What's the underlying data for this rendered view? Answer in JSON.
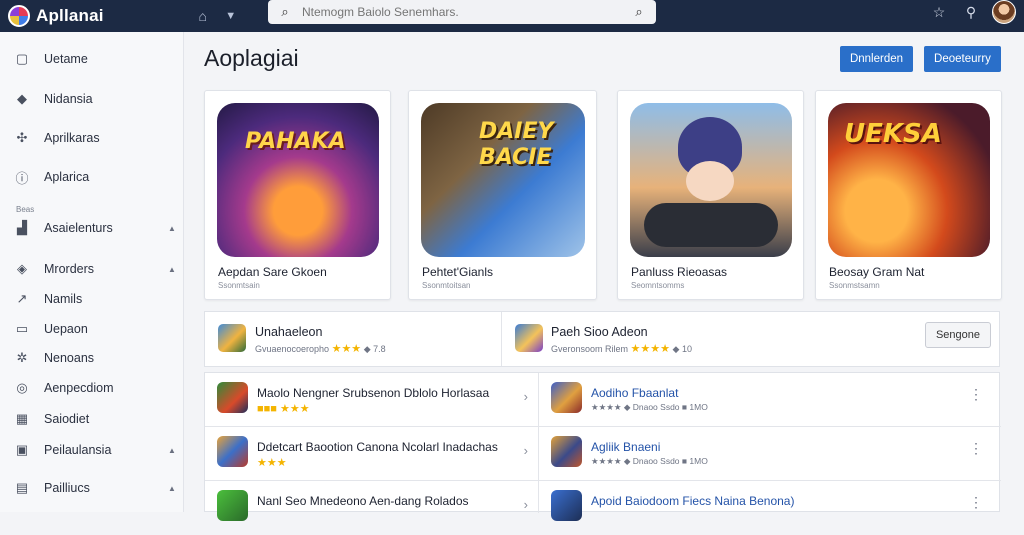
{
  "topbar": {
    "app_name": "Apllanai",
    "search_placeholder": "Ntemogm Baiolo Senemhars."
  },
  "sidebar": {
    "section_label": "Beas",
    "items": [
      {
        "label": "Uetame",
        "icon": "window-icon",
        "arrow": false
      },
      {
        "label": "Nidansia",
        "icon": "diamond-icon",
        "arrow": false
      },
      {
        "label": "Aprilkaras",
        "icon": "puzzle-icon",
        "arrow": false
      },
      {
        "label": "Aplarica",
        "icon": "info-icon",
        "arrow": false
      },
      {
        "label": "Asaielenturs",
        "icon": "chart-icon",
        "arrow": true
      },
      {
        "label": "Mrorders",
        "icon": "layers-icon",
        "arrow": true
      },
      {
        "label": "Namils",
        "icon": "trend-icon",
        "arrow": false
      },
      {
        "label": "Uepaon",
        "icon": "folder-icon",
        "arrow": false
      },
      {
        "label": "Nenoans",
        "icon": "gear-icon",
        "arrow": false
      },
      {
        "label": "Aenpecdiom",
        "icon": "globe-icon",
        "arrow": false
      },
      {
        "label": "Saiodiet",
        "icon": "calendar-icon",
        "arrow": false
      },
      {
        "label": "Peilaulansia",
        "icon": "image-icon",
        "arrow": true
      },
      {
        "label": "Pailliucs",
        "icon": "grid-icon",
        "arrow": true
      }
    ]
  },
  "main": {
    "title": "Aoplagiai",
    "btn_primary": "Dnnlerden",
    "btn_secondary": "Deoeteurry",
    "featured": [
      {
        "art_text": "PAHAKA",
        "title": "Aepdan Sare Gkoen",
        "sub": "Ssonmtsain"
      },
      {
        "art_text": "DAIEY BACIE",
        "title": "Pehtet'Gianls",
        "sub": "Ssonmtoitsan"
      },
      {
        "art_text": "",
        "title": "Panluss Rieoasas",
        "sub": "Seomntsomms"
      },
      {
        "art_text": "UEKSA",
        "title": "Beosay Gram Nat",
        "sub": "Ssonmstsamn"
      }
    ],
    "mid": [
      {
        "title": "Unahaeleon",
        "sub": "Gvuaenocoeropho",
        "stars": "★★★",
        "count": "7.8"
      },
      {
        "title": "Paeh Sioo Adeon",
        "sub": "Gveronsoom Rilem",
        "stars": "★★★★",
        "count": "10"
      }
    ],
    "secondary_button": "Sengone",
    "list_left": [
      {
        "title": "Maolo Nengner Srubsenon Dblolo Horlasaa",
        "meta": "■■■ ★★★"
      },
      {
        "title": "Ddetcart Baootion Canona Ncolarl Inadachas",
        "meta": "★★★"
      },
      {
        "title": "Nanl Seo Mnedeono Aen-dang Rolados",
        "meta": ""
      }
    ],
    "list_right": [
      {
        "title": "Aodiho Fbaanlat",
        "meta": "★★★★ ◆ Dnaoo Ssdo ■ 1MO"
      },
      {
        "title": "Agliik Bnaeni",
        "meta": "★★★★ ◆ Dnaoo Ssdo ■ 1MO"
      },
      {
        "title": "Apoid Baiodoom Fiecs Naina Benona)",
        "meta": ""
      }
    ]
  },
  "colors": {
    "topbar": "#1c2a44",
    "accent": "#2a6fc9",
    "star": "#f4b400"
  }
}
